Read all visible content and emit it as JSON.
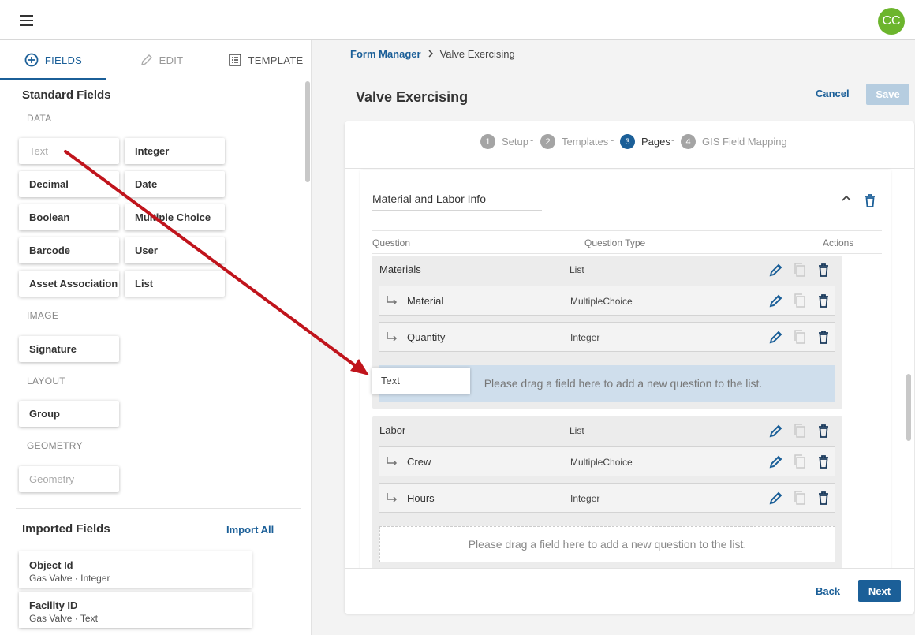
{
  "topbar": {
    "avatar_initials": "CC"
  },
  "left_panel": {
    "tabs": [
      {
        "label": "FIELDS",
        "icon": "plus-circle-icon",
        "active": true
      },
      {
        "label": "EDIT",
        "icon": "pencil-icon",
        "active": false
      },
      {
        "label": "TEMPLATE",
        "icon": "list-icon",
        "active": false
      }
    ],
    "standard_fields": {
      "title": "Standard Fields",
      "categories": [
        {
          "label": "DATA",
          "items": [
            "Text",
            "Integer",
            "Decimal",
            "Date",
            "Boolean",
            "Multiple Choice",
            "Barcode",
            "User",
            "Asset Association",
            "List"
          ]
        },
        {
          "label": "IMAGE",
          "items": [
            "Signature"
          ]
        },
        {
          "label": "LAYOUT",
          "items": [
            "Group"
          ]
        },
        {
          "label": "GEOMETRY",
          "items": [
            "Geometry"
          ]
        }
      ]
    },
    "imported_fields": {
      "title": "Imported Fields",
      "import_all_label": "Import All",
      "items": [
        {
          "name": "Object Id",
          "detail": "Gas Valve · Integer"
        },
        {
          "name": "Facility ID",
          "detail": "Gas Valve · Text"
        }
      ]
    }
  },
  "breadcrumb": {
    "parent": "Form Manager",
    "current": "Valve Exercising"
  },
  "header": {
    "title": "Valve Exercising",
    "cancel_label": "Cancel",
    "save_label": "Save"
  },
  "stepper": {
    "steps": [
      {
        "num": "1",
        "label": "Setup"
      },
      {
        "num": "2",
        "label": "Templates"
      },
      {
        "num": "3",
        "label": "Pages",
        "current": true
      },
      {
        "num": "4",
        "label": "GIS Field Mapping"
      }
    ],
    "separator": "-"
  },
  "page": {
    "name": "Material and Labor Info",
    "columns": {
      "question": "Question",
      "type": "Question Type",
      "actions": "Actions"
    },
    "groups": [
      {
        "question": "Materials",
        "type": "List",
        "children": [
          {
            "question": "Material",
            "type": "MultipleChoice"
          },
          {
            "question": "Quantity",
            "type": "Integer"
          }
        ],
        "drop_text": "Please drag a field here to add a new question to the list."
      },
      {
        "question": "Labor",
        "type": "List",
        "children": [
          {
            "question": "Crew",
            "type": "MultipleChoice"
          },
          {
            "question": "Hours",
            "type": "Integer"
          }
        ],
        "drop_text": "Please drag a field here to add a new question to the list."
      }
    ]
  },
  "drag_ghost": {
    "label": "Text"
  },
  "footer": {
    "back_label": "Back",
    "next_label": "Next"
  },
  "colors": {
    "accent": "#1b5f98",
    "avatar": "#6cb52d",
    "annotation_arrow": "#c0141c",
    "drop_active": "#cfdeec"
  }
}
